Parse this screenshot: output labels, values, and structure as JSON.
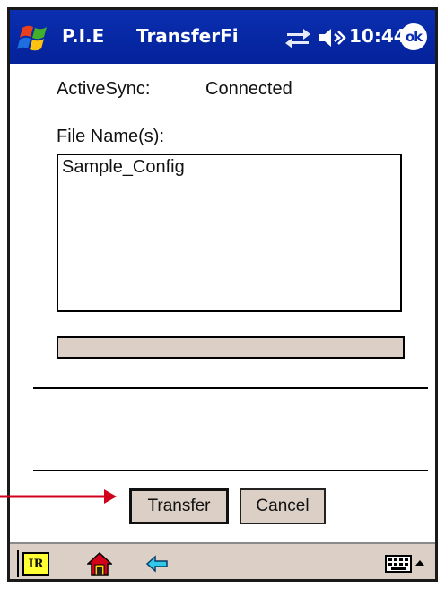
{
  "titlebar": {
    "app_name": "P.I.E",
    "window_title": "TransferFi",
    "time": "10:44",
    "ok_label": "ok",
    "start_icon": "windows-flag-icon",
    "sync_icon": "activesync-arrows-icon",
    "volume_icon": "speaker-volume-icon",
    "background_color": "#0a2fb0"
  },
  "status": {
    "activesync_label": "ActiveSync:",
    "activesync_value": "Connected"
  },
  "files": {
    "label": "File Name(s):",
    "items": [
      "Sample_Config"
    ]
  },
  "progress": {
    "value": 0,
    "fill_color": "#0a2fb0",
    "track_color": "#dccfc5"
  },
  "buttons": {
    "transfer_label": "Transfer",
    "cancel_label": "Cancel"
  },
  "annotation": {
    "arrow_color": "#d0021b",
    "arrow_target": "transfer-button"
  },
  "menubar": {
    "ir_label": "IR",
    "home_icon": "home-icon",
    "back_icon": "back-arrow-icon",
    "keyboard_icon": "keyboard-icon",
    "sip_icon": "sip-up-arrow-icon",
    "background_color": "#dccfc5"
  }
}
